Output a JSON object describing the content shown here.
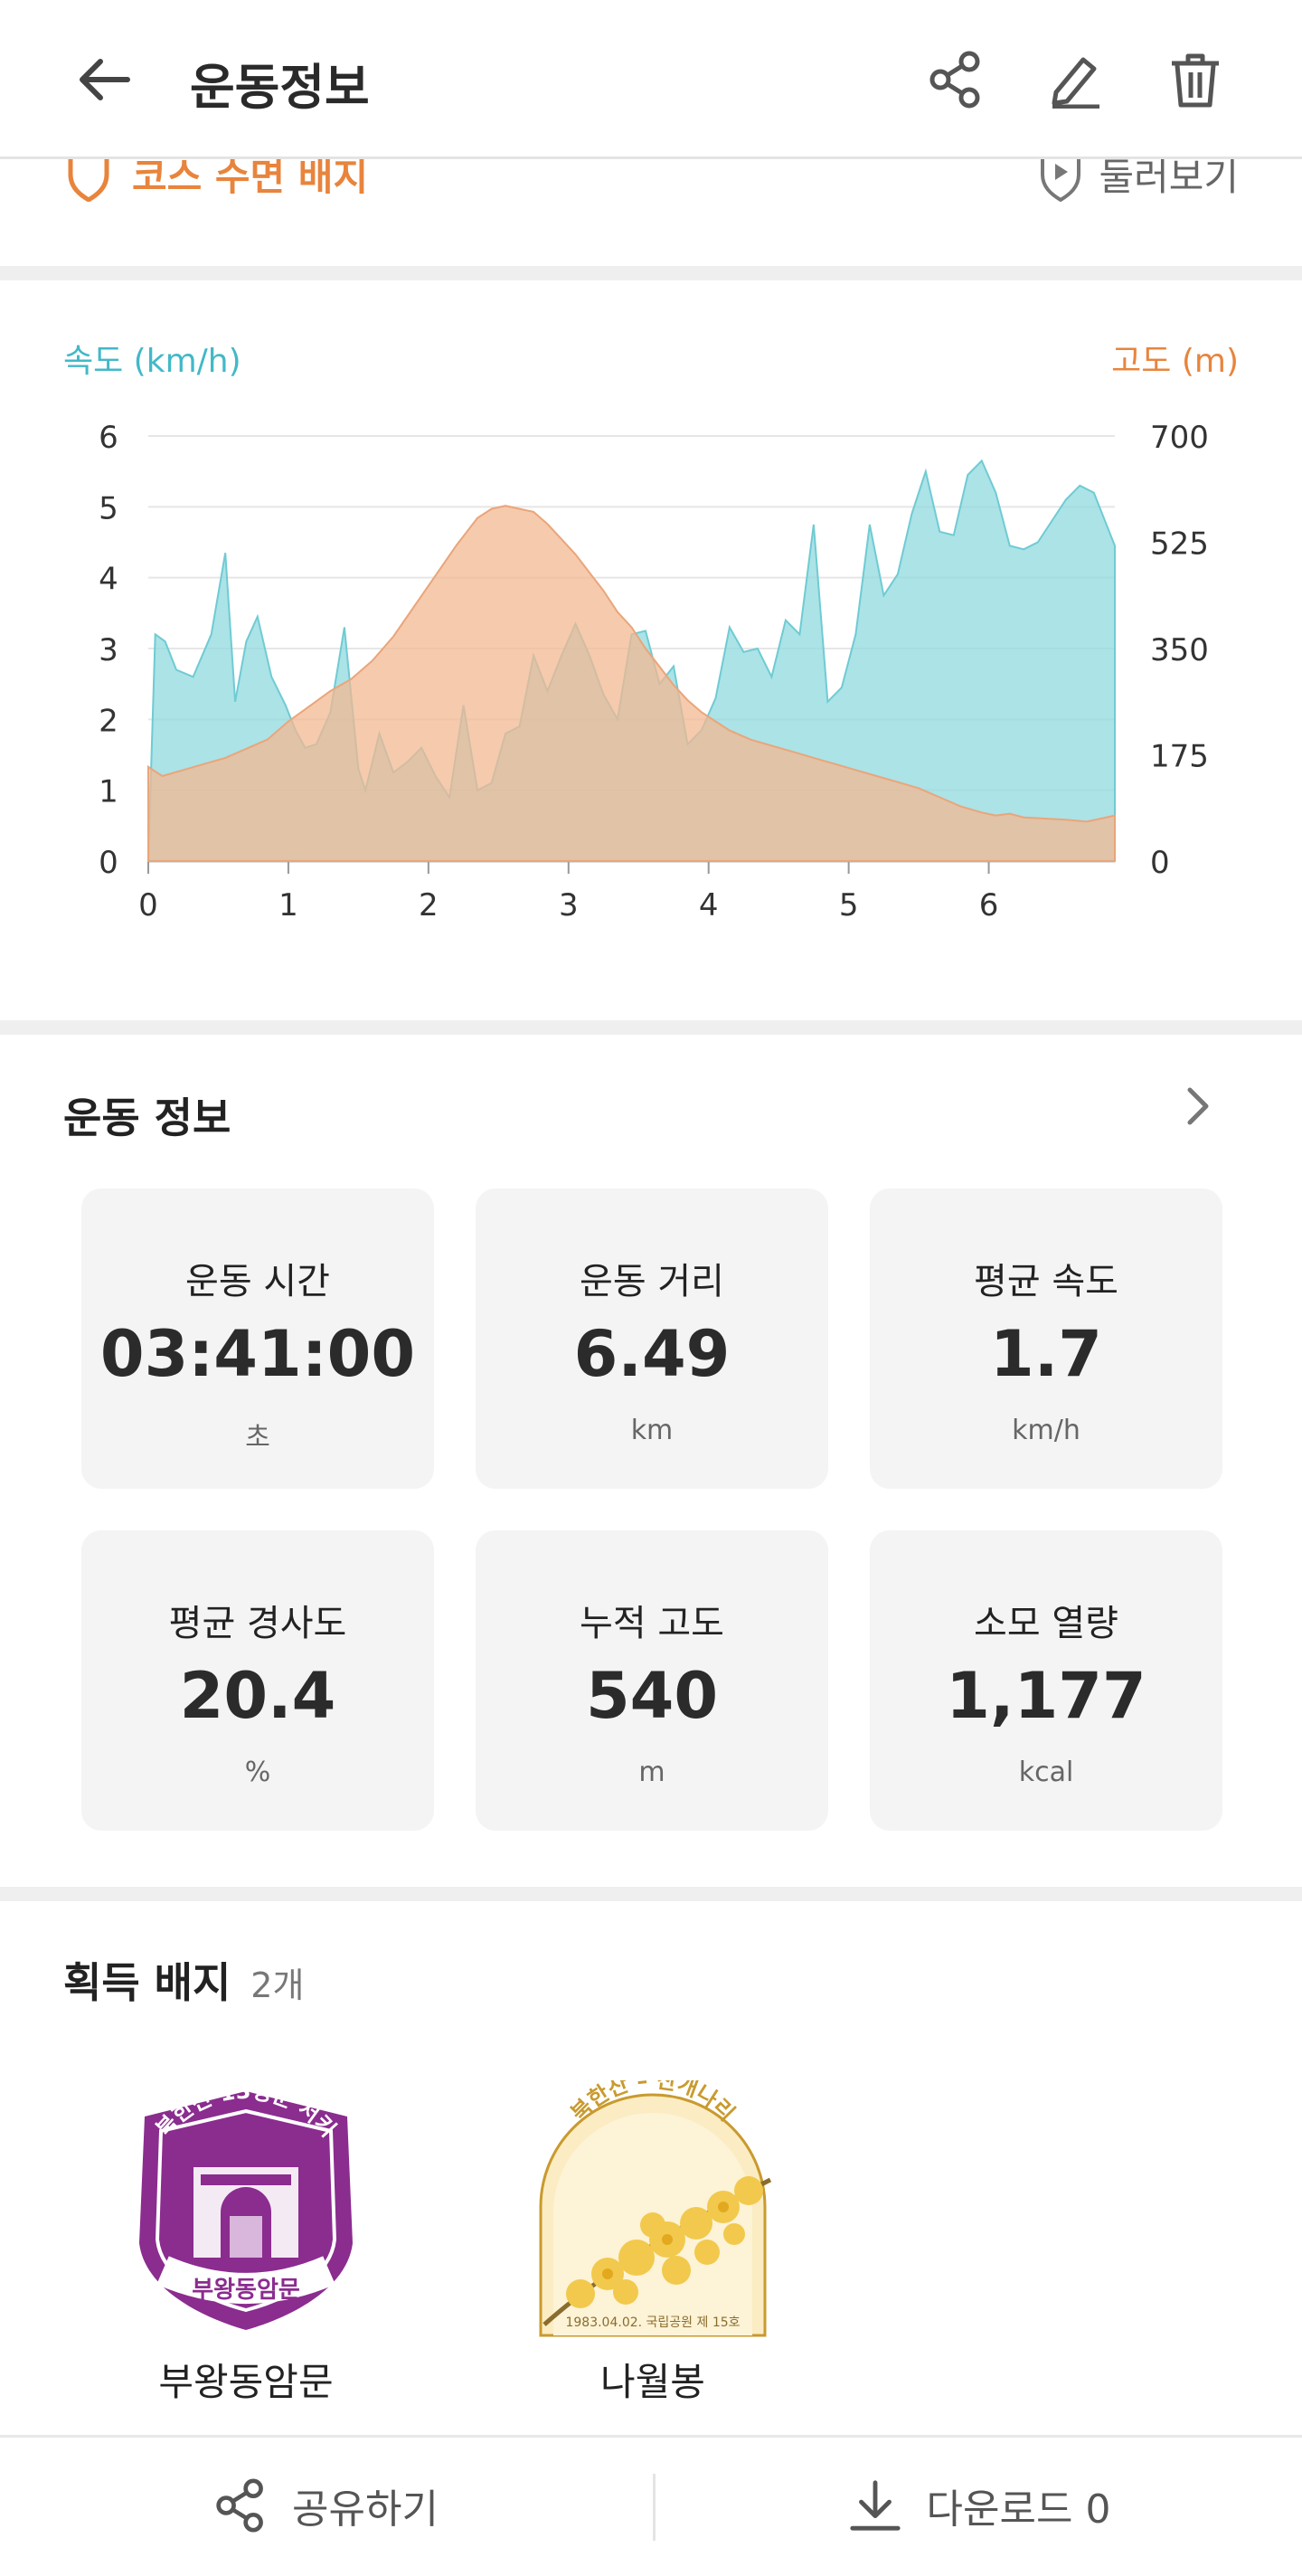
{
  "header": {
    "title": "운동정보"
  },
  "course": {
    "badge_label": "코스 수면 배지",
    "look_label": "둘러보기"
  },
  "chart_labels": {
    "left_axis": "속도 (km/h)",
    "right_axis": "고도 (m)"
  },
  "chart_data": {
    "type": "area",
    "xlabel": "",
    "xlim": [
      0,
      6.9
    ],
    "x_ticks": [
      "0",
      "1",
      "2",
      "3",
      "4",
      "5",
      "6"
    ],
    "y_left_ticks": [
      "0",
      "1",
      "2",
      "3",
      "4",
      "5",
      "6"
    ],
    "y_right_ticks": [
      "0",
      "175",
      "350",
      "525",
      "700"
    ],
    "ylim_left": [
      0,
      6
    ],
    "ylim_right": [
      0,
      700
    ],
    "grid": true,
    "colors": {
      "speed": "#8fd9df",
      "altitude": "#f3b891",
      "speed_axis": "#42b8c8",
      "altitude_axis": "#e8843c"
    },
    "series": [
      {
        "axis": "left",
        "x": [
          0,
          0.05,
          0.12,
          0.2,
          0.32,
          0.45,
          0.55,
          0.62,
          0.7,
          0.78,
          0.88,
          0.98,
          1.05,
          1.12,
          1.2,
          1.3,
          1.4,
          1.5,
          1.55,
          1.65,
          1.75,
          1.85,
          1.95,
          2.05,
          2.15,
          2.25,
          2.35,
          2.45,
          2.55,
          2.65,
          2.75,
          2.85,
          2.95,
          3.05,
          3.15,
          3.25,
          3.35,
          3.45,
          3.55,
          3.65,
          3.75,
          3.85,
          3.95,
          4.05,
          4.15,
          4.25,
          4.35,
          4.45,
          4.55,
          4.65,
          4.75,
          4.85,
          4.95,
          5.05,
          5.15,
          5.25,
          5.35,
          5.45,
          5.55,
          5.65,
          5.75,
          5.85,
          5.95,
          6.05,
          6.15,
          6.25,
          6.35,
          6.45,
          6.55,
          6.65,
          6.75,
          6.9
        ],
        "values": [
          0,
          3.2,
          3.1,
          2.7,
          2.6,
          3.2,
          4.35,
          2.25,
          3.1,
          3.45,
          2.6,
          2.2,
          1.85,
          1.6,
          1.65,
          2.1,
          3.3,
          1.3,
          1.0,
          1.8,
          1.25,
          1.4,
          1.6,
          1.2,
          0.9,
          2.2,
          1.0,
          1.1,
          1.8,
          1.9,
          2.9,
          2.4,
          2.9,
          3.35,
          2.9,
          2.35,
          2.0,
          3.2,
          3.25,
          2.5,
          2.75,
          1.65,
          1.85,
          2.3,
          3.3,
          2.95,
          3.0,
          2.6,
          3.4,
          3.2,
          4.75,
          2.25,
          2.45,
          3.2,
          4.75,
          3.75,
          4.05,
          4.9,
          5.5,
          4.65,
          4.6,
          5.45,
          5.65,
          5.2,
          4.45,
          4.4,
          4.5,
          4.8,
          5.1,
          5.3,
          5.2,
          4.45
        ]
      },
      {
        "axis": "right",
        "x": [
          0,
          0.1,
          0.25,
          0.4,
          0.55,
          0.7,
          0.85,
          1.0,
          1.15,
          1.3,
          1.45,
          1.6,
          1.75,
          1.9,
          2.05,
          2.2,
          2.35,
          2.45,
          2.55,
          2.65,
          2.75,
          2.85,
          2.95,
          3.05,
          3.15,
          3.25,
          3.35,
          3.45,
          3.55,
          3.65,
          3.75,
          3.85,
          3.95,
          4.05,
          4.15,
          4.3,
          4.45,
          4.6,
          4.75,
          4.9,
          5.05,
          5.2,
          5.35,
          5.5,
          5.65,
          5.8,
          5.95,
          6.05,
          6.15,
          6.25,
          6.4,
          6.55,
          6.7,
          6.9
        ],
        "values": [
          155,
          140,
          150,
          160,
          170,
          185,
          200,
          230,
          255,
          280,
          300,
          330,
          370,
          420,
          470,
          520,
          565,
          580,
          585,
          580,
          575,
          555,
          530,
          505,
          475,
          445,
          410,
          385,
          350,
          320,
          290,
          265,
          245,
          230,
          215,
          200,
          190,
          180,
          170,
          160,
          150,
          140,
          130,
          120,
          105,
          90,
          80,
          75,
          78,
          72,
          70,
          68,
          65,
          75
        ]
      }
    ]
  },
  "stats": {
    "title": "운동 정보",
    "cards": [
      {
        "label": "운동 시간",
        "value": "03:41:00",
        "unit": "초"
      },
      {
        "label": "운동 거리",
        "value": "6.49",
        "unit": "km"
      },
      {
        "label": "평균 속도",
        "value": "1.7",
        "unit": "km/h"
      },
      {
        "label": "평균 경사도",
        "value": "20.4",
        "unit": "%"
      },
      {
        "label": "누적 고도",
        "value": "540",
        "unit": "m"
      },
      {
        "label": "소모 열량",
        "value": "1,177",
        "unit": "kcal"
      }
    ]
  },
  "badges": {
    "title": "획득 배지",
    "count": "2개",
    "items": [
      {
        "name": "부왕동암문",
        "arc_text": "북한산 13성문 서키",
        "inner_text": "부왕동암문",
        "color": "#8b2c8f"
      },
      {
        "name": "나월봉",
        "arc_text": "북한산 – 산개나리",
        "date_text": "1983.04.02. 국립공원 제 15호",
        "color": "#f2c94c"
      }
    ]
  },
  "bottom": {
    "share_label": "공유하기",
    "download_label": "다운로드 0"
  },
  "icons": {
    "back": "arrow-left-icon",
    "share": "share-icon",
    "edit": "pencil-icon",
    "delete": "trash-icon"
  }
}
